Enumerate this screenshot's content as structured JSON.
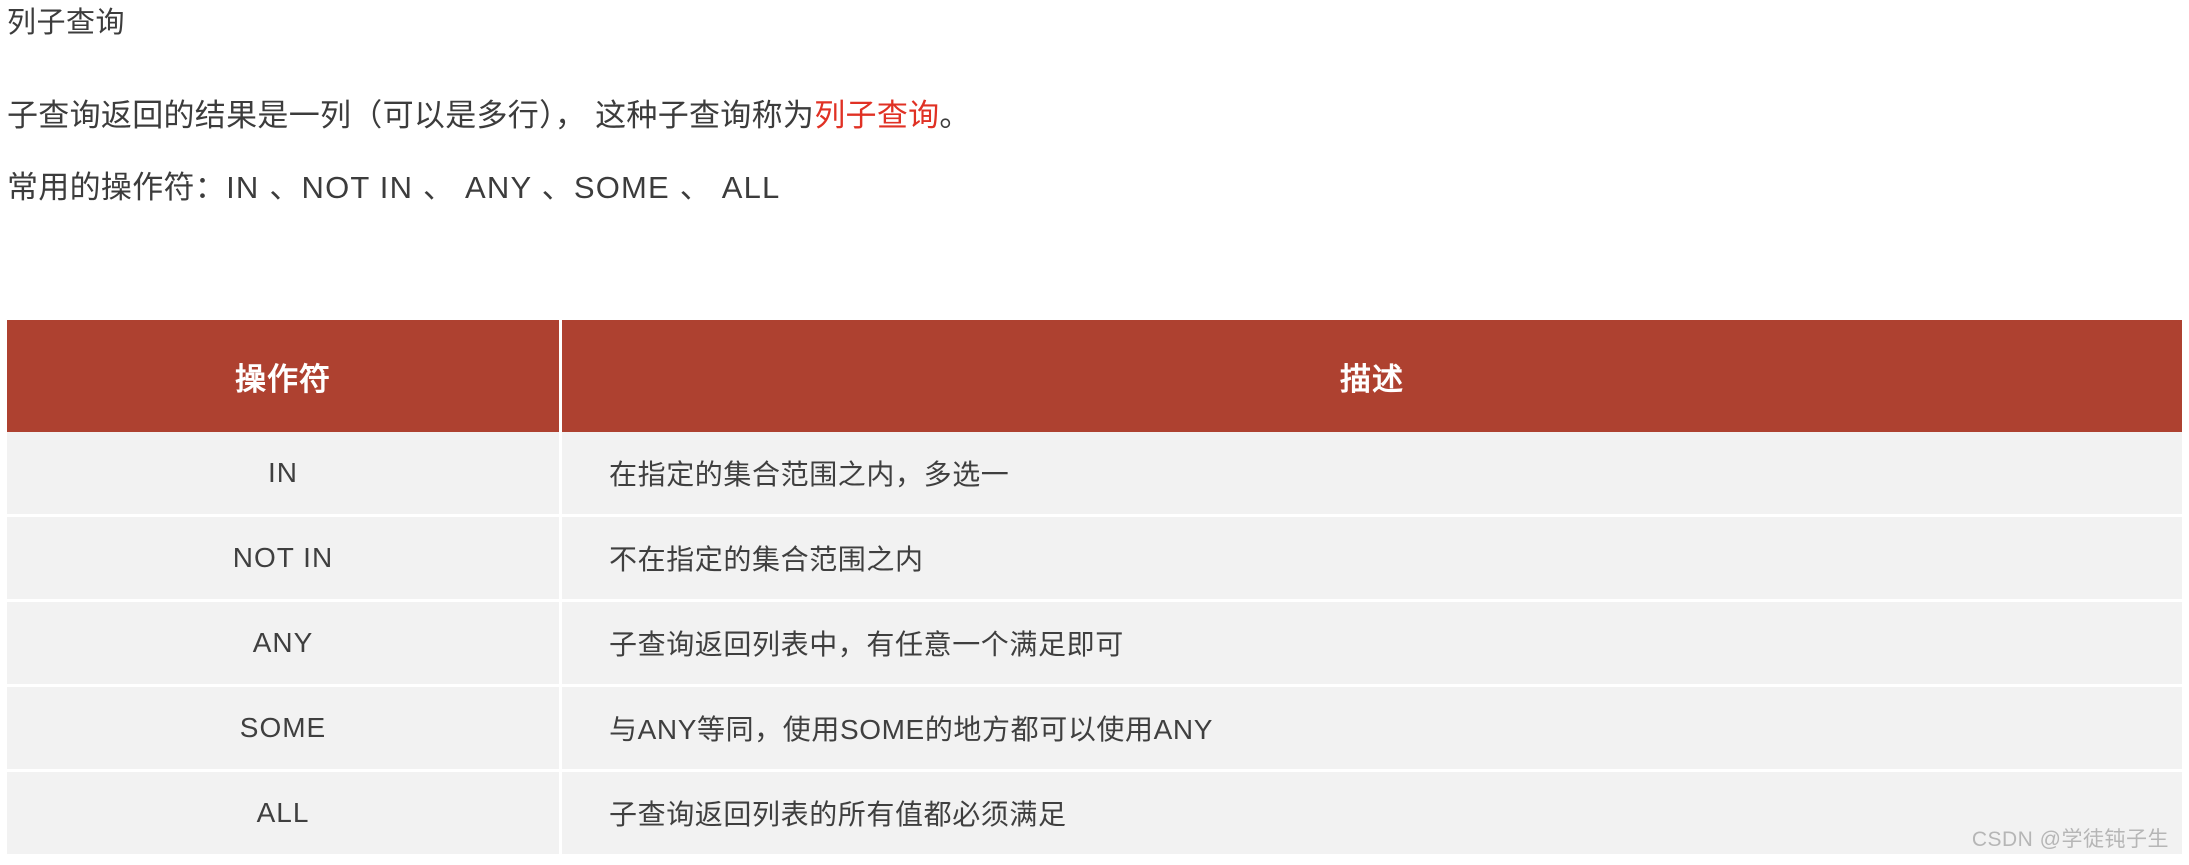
{
  "document": {
    "heading": "列子查询",
    "paragraphs": {
      "definition_prefix": "子查询返回的结果是一列（可以是多行）， 这种子查询称为",
      "definition_highlight": "列子查询",
      "definition_suffix": "。",
      "operators_label": "常用的操作符：",
      "operators_list": "IN 、NOT IN 、 ANY 、SOME 、 ALL"
    }
  },
  "table": {
    "headers": {
      "operator": "操作符",
      "description": "描述"
    },
    "rows": [
      {
        "operator": "IN",
        "description": "在指定的集合范围之内，多选一"
      },
      {
        "operator": "NOT IN",
        "description": "不在指定的集合范围之内"
      },
      {
        "operator": "ANY",
        "description": "子查询返回列表中，有任意一个满足即可"
      },
      {
        "operator": "SOME",
        "description": "与ANY等同，使用SOME的地方都可以使用ANY"
      },
      {
        "operator": "ALL",
        "description": "子查询返回列表的所有值都必须满足"
      }
    ]
  },
  "watermark": {
    "text": "CSDN @学徒钝子生"
  },
  "colors": {
    "header_background": "#ae4130",
    "row_background": "#f2f2f2",
    "accent_red": "#e03124",
    "body_text": "#3c3c3c"
  }
}
